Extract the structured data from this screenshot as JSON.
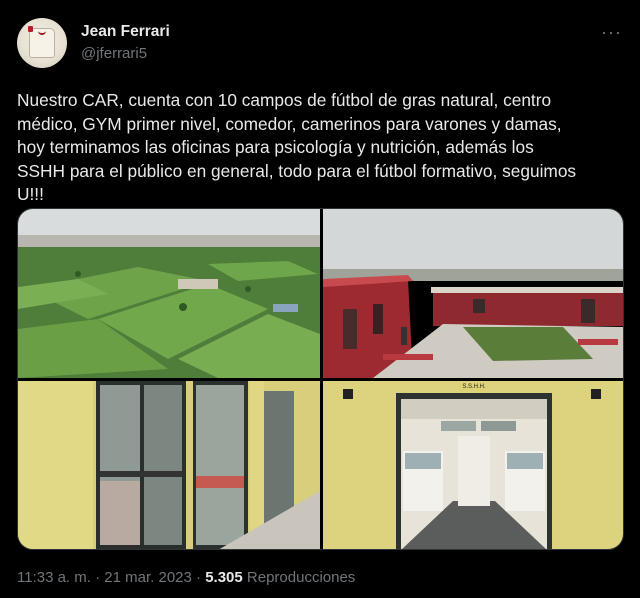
{
  "author": {
    "name": "Jean Ferrari",
    "handle": "@jferrari5"
  },
  "tweet": {
    "text": "Nuestro CAR, cuenta con 10 campos de fútbol de gras natural, centro\nmédico, GYM primer nivel, comedor, camerinos para varones y damas,\nhoy terminamos las oficinas para psicología y nutrición, además los\nSSHH para el público en general, todo para el fútbol formativo, seguimos\nU!!!"
  },
  "photo_signs": {
    "bathroom_sign": "S.S.H.H."
  },
  "meta": {
    "time": "11:33 a. m.",
    "sep1": "·",
    "date": "21 mar. 2023",
    "sep2": "·",
    "views_count": "5.305",
    "views_label": "Reproducciones"
  },
  "icons": {
    "more": "more-options-icon"
  },
  "colors": {
    "background": "#000000",
    "text": "#e7e9ea",
    "secondary": "#71767b"
  }
}
